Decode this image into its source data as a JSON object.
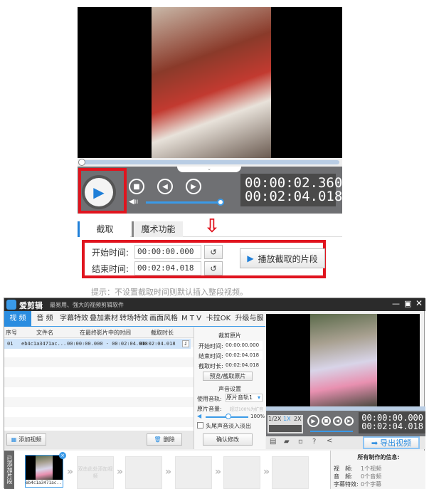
{
  "top": {
    "time_current": "00:00:02.360",
    "time_total": "00:02:04.018",
    "volume_percent": 100,
    "progress_fraction": 0.02,
    "tabs": [
      "截取",
      "魔术功能"
    ],
    "start_label": "开始时间:",
    "start_value": "00:00:00.000",
    "end_label": "结束时间:",
    "end_value": "00:02:04.018",
    "play_clip_label": "播放截取的片段",
    "hint": "提示：不设置截取时间则默认插入整段视频。"
  },
  "app": {
    "name": "爱剪辑",
    "slogan": "最易用、强大的视频剪辑软件",
    "tabs": [
      "视 频",
      "音 频",
      "字幕特效",
      "叠加素材",
      "转场特效",
      "画面风格",
      "M T V",
      "卡拉OK",
      "升级与服务"
    ],
    "table": {
      "headers": [
        "序号",
        "文件名",
        "在最终影片中的时间",
        "截取时长"
      ],
      "rows": [
        [
          "01",
          "eb4c1a3471ac...",
          "00:00:00.000 - 00:02:04.018",
          "00:02:04.018"
        ]
      ]
    },
    "add_video": "添加视频",
    "delete": "删除",
    "panel": {
      "clip_title": "裁剪原片",
      "start_label": "开始时间:",
      "start_value": "00:00:00.000",
      "end_label": "结束时间:",
      "end_value": "00:02:04.018",
      "dur_label": "截取时长:",
      "dur_value": "00:02:04.018",
      "preview_btn": "预览/截取原片",
      "sound_title": "声音设置",
      "track_label": "使用音轨:",
      "track_value": "原片音轨1",
      "volume_label": "原片音量:",
      "volume_hint": "超过100%为扩音",
      "volume_value": "100%",
      "fade_label": "头尾声音淡入淡出",
      "confirm": "确认修改"
    },
    "preview": {
      "speeds": [
        "1/2X",
        "1X",
        "2X"
      ],
      "time_current": "00:00:00.000",
      "time_total": "00:02:04.018",
      "export": "导出视频"
    },
    "timeline": {
      "side_label": "已添加片段",
      "clip_name": "eb4c1a3471ac...",
      "placeholder": "双击此处添加视频"
    },
    "info": {
      "title": "所有制作的信息:",
      "rows": [
        [
          "视　频:",
          "1个视频"
        ],
        [
          "音　频:",
          "0个音频"
        ],
        [
          "字幕特效:",
          "0个字幕"
        ]
      ]
    }
  }
}
